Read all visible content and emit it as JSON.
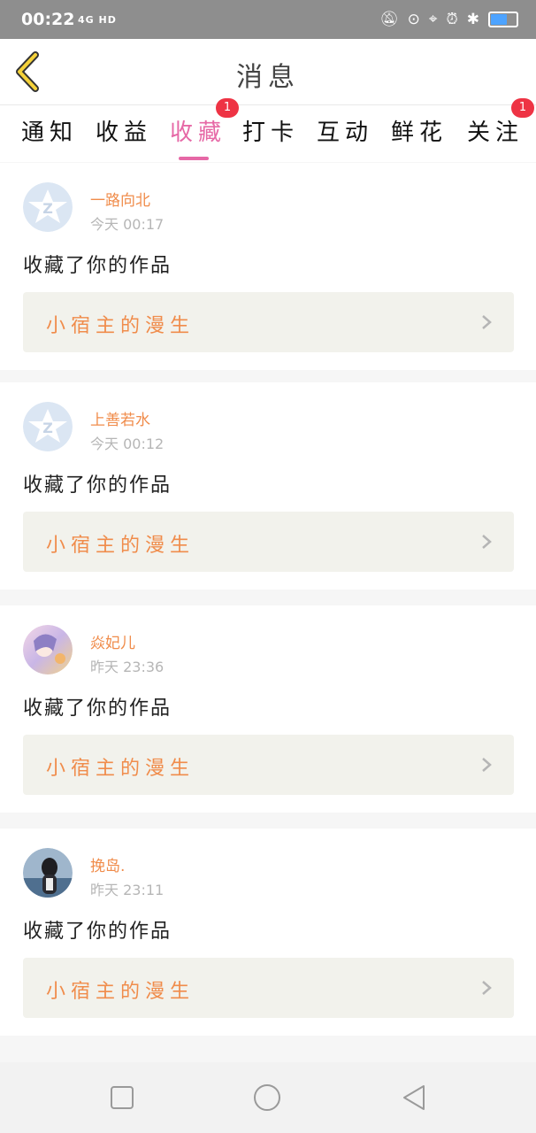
{
  "status_bar": {
    "time": "00:22",
    "network": "4G HD"
  },
  "header": {
    "title": "消息"
  },
  "tabs": [
    {
      "label": "通知"
    },
    {
      "label": "收益"
    },
    {
      "label": "收藏",
      "badge": "1",
      "active": true
    },
    {
      "label": "打卡"
    },
    {
      "label": "互动"
    },
    {
      "label": "鲜花"
    },
    {
      "label": "关注",
      "badge": "1"
    }
  ],
  "messages": [
    {
      "username": "一路向北",
      "time": "今天 00:17",
      "action": "收藏了你的作品",
      "work_title": "小宿主的漫生",
      "avatar": "default-avatar"
    },
    {
      "username": "上善若水",
      "time": "今天 00:12",
      "action": "收藏了你的作品",
      "work_title": "小宿主的漫生",
      "avatar": "default-avatar"
    },
    {
      "username": "焱妃儿",
      "time": "昨天 23:36",
      "action": "收藏了你的作品",
      "work_title": "小宿主的漫生",
      "avatar": "anime-avatar"
    },
    {
      "username": "挽岛.",
      "time": "昨天 23:11",
      "action": "收藏了你的作品",
      "work_title": "小宿主的漫生",
      "avatar": "photo-avatar"
    }
  ],
  "colors": {
    "accent": "#e668a6",
    "username": "#f08c4b",
    "badge": "#ee3344"
  }
}
